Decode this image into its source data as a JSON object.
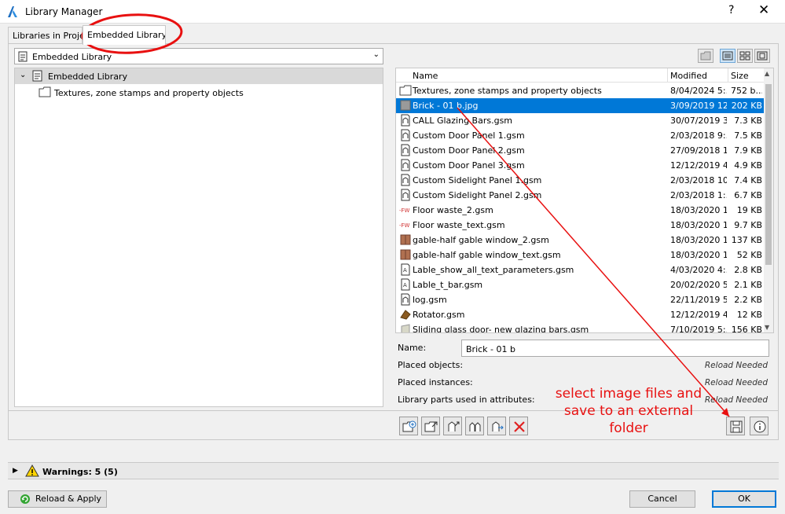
{
  "window": {
    "title": "Library Manager",
    "help": "?",
    "close": "✕"
  },
  "tabs": [
    {
      "label": "Libraries in Project"
    },
    {
      "label": "Embedded Library"
    }
  ],
  "library_select": {
    "value": "Embedded Library"
  },
  "tree": {
    "root": "Embedded Library",
    "child": "Textures, zone stamps and property objects"
  },
  "list": {
    "columns": {
      "name": "Name",
      "modified": "Modified",
      "size": "Size"
    },
    "rows": [
      {
        "icon": "folder-icon",
        "name": "Textures, zone stamps and property objects",
        "modified": "8/04/2024 5:...",
        "size": "752 b..."
      },
      {
        "icon": "image-file-icon",
        "name": "Brick - 01 b.jpg",
        "modified": "3/09/2019 12...",
        "size": "202 KB",
        "selected": true
      },
      {
        "icon": "gsm-object-icon",
        "name": "CALL Glazing Bars.gsm",
        "modified": "30/07/2019 3...",
        "size": "7.3 KB"
      },
      {
        "icon": "gsm-object-icon",
        "name": "Custom Door Panel 1.gsm",
        "modified": "2/03/2018 9:...",
        "size": "7.5 KB"
      },
      {
        "icon": "gsm-object-icon",
        "name": "Custom Door Panel 2.gsm",
        "modified": "27/09/2018 1...",
        "size": "7.9 KB"
      },
      {
        "icon": "gsm-object-icon",
        "name": "Custom Door Panel 3.gsm",
        "modified": "12/12/2019 4...",
        "size": "4.9 KB"
      },
      {
        "icon": "gsm-object-icon",
        "name": "Custom Sidelight Panel 1.gsm",
        "modified": "2/03/2018 10...",
        "size": "7.4 KB"
      },
      {
        "icon": "gsm-object-icon",
        "name": "Custom Sidelight Panel 2.gsm",
        "modified": "2/03/2018 1:...",
        "size": "6.7 KB"
      },
      {
        "icon": "floor-waste-icon",
        "name": "Floor waste_2.gsm",
        "modified": "18/03/2020 1...",
        "size": "19 KB"
      },
      {
        "icon": "floor-waste-icon",
        "name": "Floor waste_text.gsm",
        "modified": "18/03/2020 1...",
        "size": "9.7 KB"
      },
      {
        "icon": "window-object-icon",
        "name": "gable-half gable window_2.gsm",
        "modified": "18/03/2020 1...",
        "size": "137 KB"
      },
      {
        "icon": "window-object-icon",
        "name": "gable-half gable window_text.gsm",
        "modified": "18/03/2020 1...",
        "size": "52 KB"
      },
      {
        "icon": "label-object-icon",
        "name": "Lable_show_all_text_parameters.gsm",
        "modified": "4/03/2020 4:...",
        "size": "2.8 KB"
      },
      {
        "icon": "label-object-icon",
        "name": "Lable_t_bar.gsm",
        "modified": "20/02/2020 5...",
        "size": "2.1 KB"
      },
      {
        "icon": "gsm-object-icon",
        "name": "log.gsm",
        "modified": "22/11/2019 5...",
        "size": "2.2 KB"
      },
      {
        "icon": "rotator-object-icon",
        "name": "Rotator.gsm",
        "modified": "12/12/2019 4...",
        "size": "12 KB"
      },
      {
        "icon": "door-object-icon",
        "name": "Sliding glass door- new glazing bars.gsm",
        "modified": "7/10/2019 5:...",
        "size": "156 KB"
      }
    ]
  },
  "properties": {
    "name_label": "Name:",
    "name_value": "Brick - 01 b",
    "placed_objects_label": "Placed objects:",
    "placed_objects_value": "Reload Needed",
    "placed_instances_label": "Placed instances:",
    "placed_instances_value": "Reload Needed",
    "attributes_label": "Library parts used in attributes:",
    "attributes_value": "Reload Needed"
  },
  "warnings": {
    "label": "Warnings: 5 (5)"
  },
  "footer": {
    "reload": "Reload & Apply",
    "cancel": "Cancel",
    "ok": "OK"
  },
  "annotation": {
    "text": "select image files and save to an external folder",
    "color": "#e81010"
  },
  "colors": {
    "selection": "#0078d7",
    "primary_border": "#0078d7"
  }
}
